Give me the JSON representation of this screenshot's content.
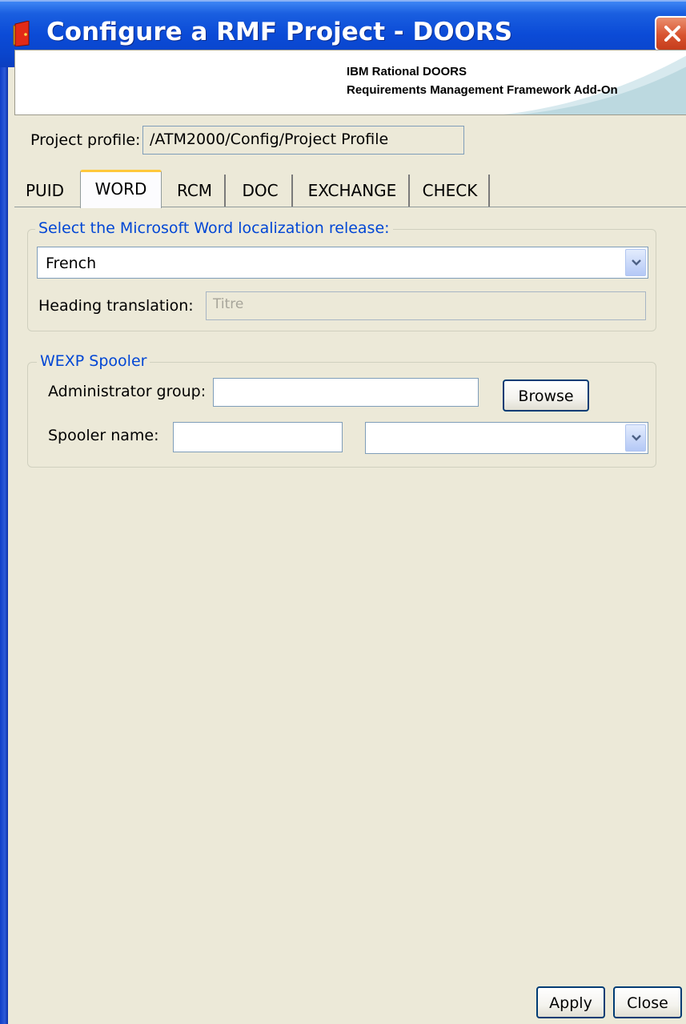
{
  "window": {
    "title": "Configure a RMF Project - DOORS"
  },
  "banner": {
    "line1": "IBM Rational DOORS",
    "line2": "Requirements Management Framework Add-On"
  },
  "project_profile": {
    "label": "Project profile:",
    "value": "/ATM2000/Config/Project Profile"
  },
  "tabs": [
    {
      "label": "PUID",
      "active": false
    },
    {
      "label": "WORD",
      "active": true
    },
    {
      "label": "RCM",
      "active": false
    },
    {
      "label": "DOC",
      "active": false
    },
    {
      "label": "EXCHANGE",
      "active": false
    },
    {
      "label": "CHECK",
      "active": false
    }
  ],
  "localization": {
    "legend": "Select the Microsoft Word localization release:",
    "selected": "French",
    "heading_label": "Heading translation:",
    "heading_value": "Titre"
  },
  "spooler": {
    "legend": "WEXP Spooler",
    "admin_label": "Administrator group:",
    "admin_value": "",
    "browse_label": "Browse",
    "spooler_label": "Spooler name:",
    "spooler_value": "",
    "spooler_select": ""
  },
  "footer": {
    "apply_label": "Apply",
    "close_label": "Close"
  }
}
